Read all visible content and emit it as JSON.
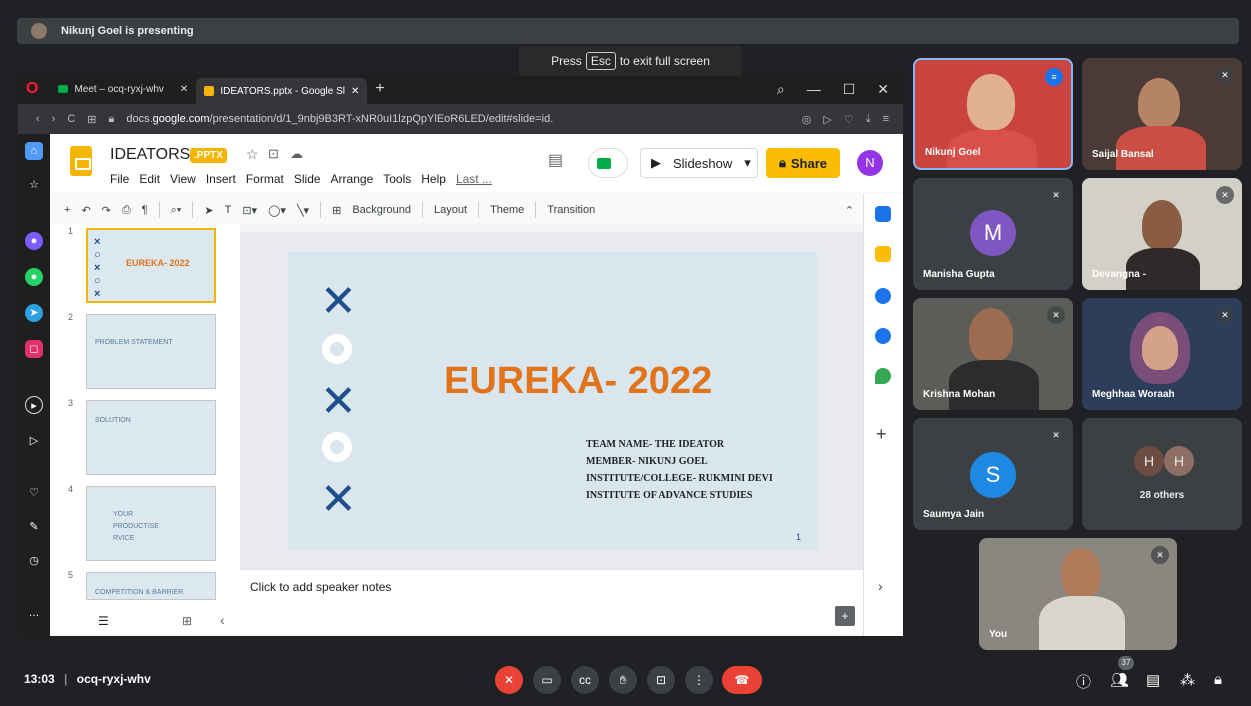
{
  "presenter_banner": "Nikunj Goel is presenting",
  "fullscreen_note": {
    "pre": "Press",
    "key": "Esc",
    "post": "to exit full screen"
  },
  "browser": {
    "tabs": [
      {
        "label": "Meet – ocq-ryxj-whv",
        "active": false
      },
      {
        "label": "IDEATORS.pptx - Google Sl",
        "active": true
      }
    ],
    "new_tab": "+",
    "url_prefix": "docs.",
    "url_domain": "google.com",
    "url_rest": "/presentation/d/1_9nbj9B3RT-xNR0uI1lzpQpYlEoR6LED/edit#slide=id."
  },
  "slides_app": {
    "title": "IDEATORS",
    "badge": ".PPTX",
    "menu": [
      "File",
      "Edit",
      "View",
      "Insert",
      "Format",
      "Slide",
      "Arrange",
      "Tools",
      "Help",
      "Last ..."
    ],
    "slideshow_label": "Slideshow",
    "share_label": "Share",
    "user_initial": "N",
    "toolbar": {
      "background": "Background",
      "layout": "Layout",
      "theme": "Theme",
      "transition": "Transition"
    },
    "thumbnails": [
      {
        "num": "1",
        "title": "EUREKA- 2022"
      },
      {
        "num": "2",
        "title": "PROBLEM STATEMENT"
      },
      {
        "num": "3",
        "title": "SOLUTION"
      },
      {
        "num": "4",
        "title": "YOUR PRODUCT/SE RVICE"
      },
      {
        "num": "5",
        "title": "COMPETITION & BARRIER"
      }
    ],
    "slide": {
      "title": "EUREKA- 2022",
      "lines": [
        "TEAM NAME- THE IDEATOR",
        "MEMBER- NIKUNJ GOEL",
        "INSTITUTE/COLLEGE- RUKMINI DEVI",
        "INSTITUTE OF ADVANCE STUDIES"
      ],
      "page_number": "1"
    },
    "speaker_notes": "Click to add speaker notes"
  },
  "participants": [
    {
      "name": "Nikunj Goel"
    },
    {
      "name": "Saijal Bansal"
    },
    {
      "name": "Manisha Gupta",
      "initial": "M"
    },
    {
      "name": "Devangna -"
    },
    {
      "name": "Krishna Mohan"
    },
    {
      "name": "Meghhaa Woraah"
    },
    {
      "name": "Saumya Jain",
      "initial": "S"
    },
    {
      "name": "28 others",
      "initials": [
        "H",
        "H"
      ]
    },
    {
      "name": "You"
    }
  ],
  "bottom_bar": {
    "time": "13:03",
    "meeting_code": "ocq-ryxj-whv",
    "people_count": "37"
  },
  "colors": {
    "slide_title": "#e2731b",
    "slide_marks": "#1f4e8c",
    "share": "#fbbc04",
    "end_call": "#ea4335"
  }
}
